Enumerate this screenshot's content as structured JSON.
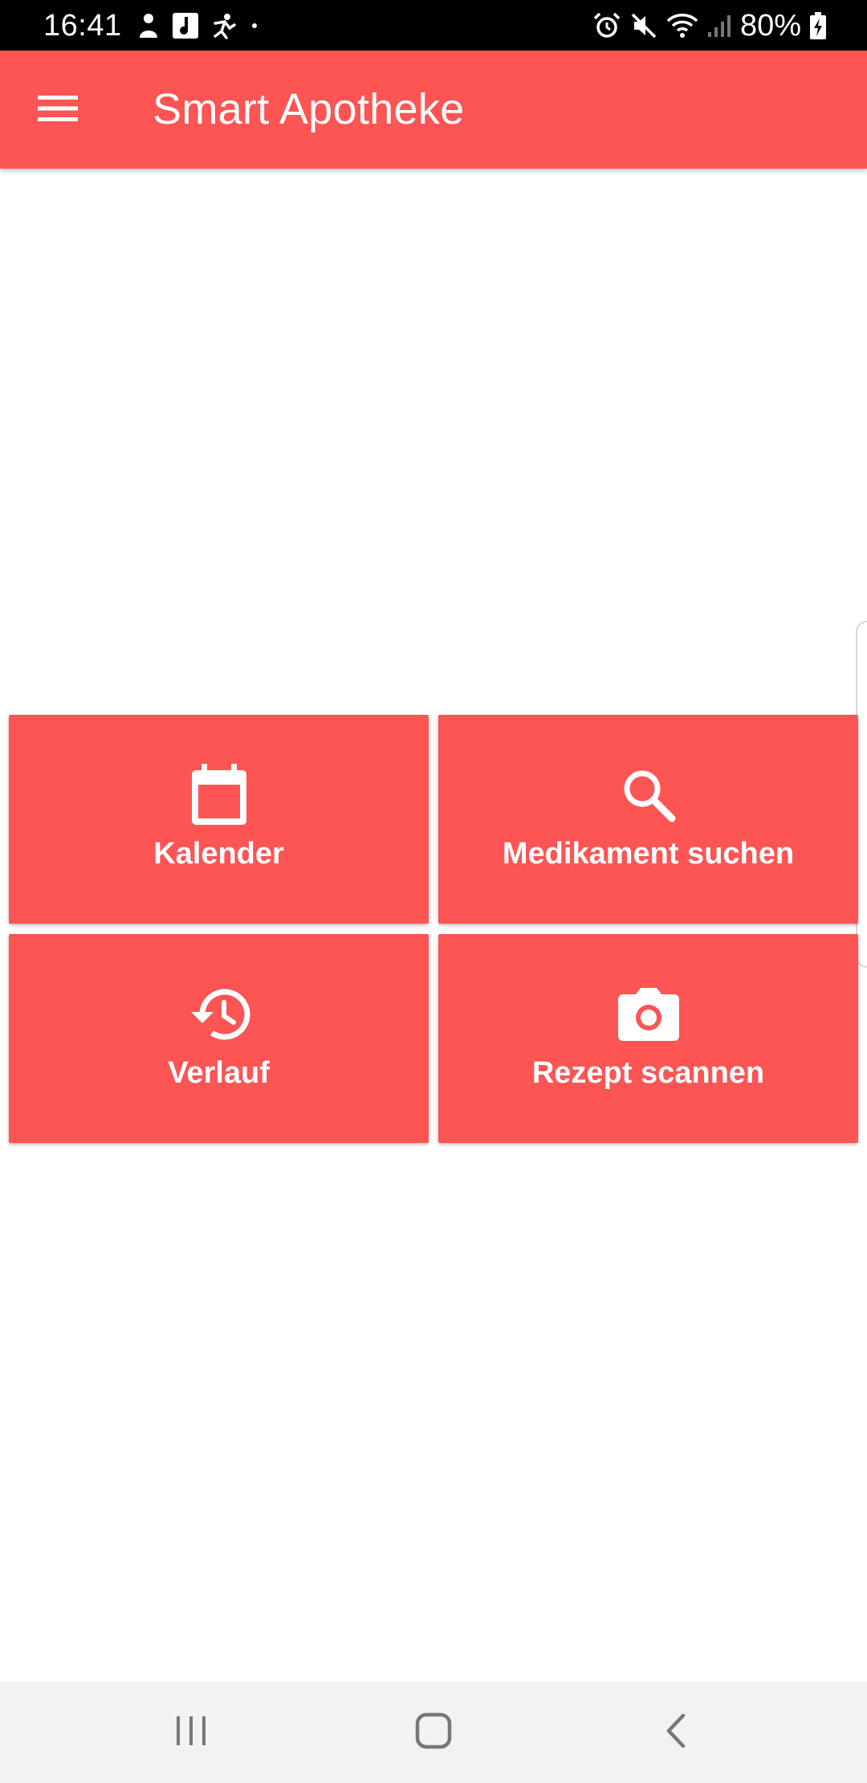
{
  "status_bar": {
    "time": "16:41",
    "battery_percent": "80%",
    "left_icons": [
      "notification-person-icon",
      "music-app-icon",
      "notification-figure-icon",
      "dot-icon"
    ],
    "right_icons": [
      "alarm-icon",
      "mute-icon",
      "wifi-icon",
      "signal-icon",
      "battery-charging-icon"
    ]
  },
  "app_bar": {
    "title": "Smart Apotheke",
    "menu_icon": "hamburger-menu-icon"
  },
  "tiles": [
    {
      "label": "Kalender",
      "icon": "calendar-icon"
    },
    {
      "label": "Medikament suchen",
      "icon": "search-icon"
    },
    {
      "label": "Verlauf",
      "icon": "history-icon"
    },
    {
      "label": "Rezept scannen",
      "icon": "camera-icon"
    }
  ],
  "nav_bar": {
    "buttons": [
      "recent-apps-icon",
      "home-icon",
      "back-icon"
    ]
  },
  "colors": {
    "primary": "#fd5454",
    "on_primary": "#ffffff",
    "status_bar": "#000000",
    "nav_bar": "#f2f2f2",
    "background": "#ffffff"
  }
}
